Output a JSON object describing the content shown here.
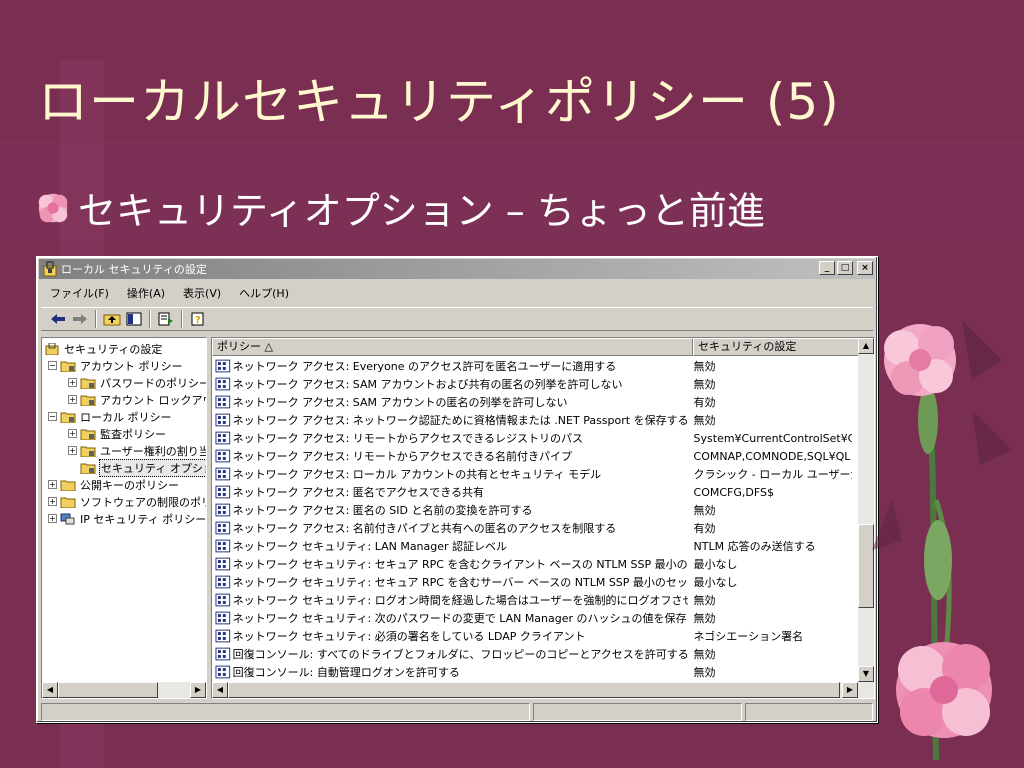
{
  "slide": {
    "title": "ローカルセキュリティポリシー (5)",
    "bullet": "セキュリティオプション – ちょっと前進"
  },
  "colors": {
    "background": "#7a2e52",
    "title_text": "#fff8cf",
    "window_face": "#d4d0c8",
    "titlebar_inactive": "#808080"
  },
  "window": {
    "title": "ローカル セキュリティの設定",
    "buttons": {
      "minimize": "_",
      "maximize": "□",
      "close": "×"
    },
    "menu": [
      "ファイル(F)",
      "操作(A)",
      "表示(V)",
      "ヘルプ(H)"
    ],
    "toolbar_icons": [
      "back-arrow-icon",
      "forward-arrow-icon",
      "up-folder-icon",
      "show-tree-icon",
      "export-list-icon",
      "help-icon"
    ]
  },
  "tree": [
    {
      "label": "セキュリティの設定",
      "expander": "",
      "icon": "security-settings-icon"
    },
    {
      "label": "アカウント ポリシー",
      "expander": "−",
      "icon": "folder-lock-icon"
    },
    {
      "label": "パスワードのポリシー",
      "expander": "+",
      "icon": "folder-lock-icon"
    },
    {
      "label": "アカウント ロックアウト",
      "expander": "+",
      "icon": "folder-lock-icon"
    },
    {
      "label": "ローカル ポリシー",
      "expander": "−",
      "icon": "folder-lock-icon"
    },
    {
      "label": "監査ポリシー",
      "expander": "+",
      "icon": "folder-lock-icon"
    },
    {
      "label": "ユーザー権利の割り当て",
      "expander": "+",
      "icon": "folder-lock-icon"
    },
    {
      "label": "セキュリティ オプション",
      "expander": "",
      "icon": "folder-lock-icon",
      "selected": true
    },
    {
      "label": "公開キーのポリシー",
      "expander": "+",
      "icon": "folder-icon"
    },
    {
      "label": "ソフトウェアの制限のポリシー",
      "expander": "+",
      "icon": "folder-icon"
    },
    {
      "label": "IP セキュリティ ポリシー",
      "expander": "+",
      "icon": "ip-security-icon"
    }
  ],
  "list": {
    "columns": [
      "ポリシー △",
      "セキュリティの設定"
    ],
    "rows": [
      {
        "policy": "ネットワーク アクセス: Everyone のアクセス許可を匿名ユーザーに適用する",
        "setting": "無効"
      },
      {
        "policy": "ネットワーク アクセス: SAM アカウントおよび共有の匿名の列挙を許可しない",
        "setting": "無効"
      },
      {
        "policy": "ネットワーク アクセス: SAM アカウントの匿名の列挙を許可しない",
        "setting": "有効"
      },
      {
        "policy": "ネットワーク アクセス: ネットワーク認証ために資格情報または .NET Passport を保存するこ...",
        "setting": "無効"
      },
      {
        "policy": "ネットワーク アクセス: リモートからアクセスできるレジストリのパス",
        "setting": "System¥CurrentControlSet¥C"
      },
      {
        "policy": "ネットワーク アクセス: リモートからアクセスできる名前付きパイプ",
        "setting": "COMNAP,COMNODE,SQL¥QL"
      },
      {
        "policy": "ネットワーク アクセス: ローカル アカウントの共有とセキュリティ モデル",
        "setting": "クラシック - ローカル ユーザーが"
      },
      {
        "policy": "ネットワーク アクセス: 匿名でアクセスできる共有",
        "setting": "COMCFG,DFS$"
      },
      {
        "policy": "ネットワーク アクセス: 匿名の SID と名前の変換を許可する",
        "setting": "無効"
      },
      {
        "policy": "ネットワーク アクセス: 名前付きパイプと共有への匿名のアクセスを制限する",
        "setting": "有効"
      },
      {
        "policy": "ネットワーク セキュリティ: LAN Manager 認証レベル",
        "setting": "NTLM 応答のみ送信する"
      },
      {
        "policy": "ネットワーク セキュリティ: セキュア RPC を含むクライアント ベースの NTLM SSP 最小のセッ...",
        "setting": "最小なし"
      },
      {
        "policy": "ネットワーク セキュリティ: セキュア RPC を含むサーバー ベースの NTLM SSP 最小のセッシ...",
        "setting": "最小なし"
      },
      {
        "policy": "ネットワーク セキュリティ: ログオン時間を経過した場合はユーザーを強制的にログオフさせる",
        "setting": "無効"
      },
      {
        "policy": "ネットワーク セキュリティ: 次のパスワードの変更で LAN Manager のハッシュの値を保存しな...",
        "setting": "無効"
      },
      {
        "policy": "ネットワーク セキュリティ: 必須の署名をしている LDAP クライアント",
        "setting": "ネゴシエーション署名"
      },
      {
        "policy": "回復コンソール: すべてのドライブとフォルダに、フロッピーのコピーとアクセスを許可する",
        "setting": "無効"
      },
      {
        "policy": "回復コンソール: 自動管理ログオンを許可する",
        "setting": "無効"
      }
    ]
  }
}
